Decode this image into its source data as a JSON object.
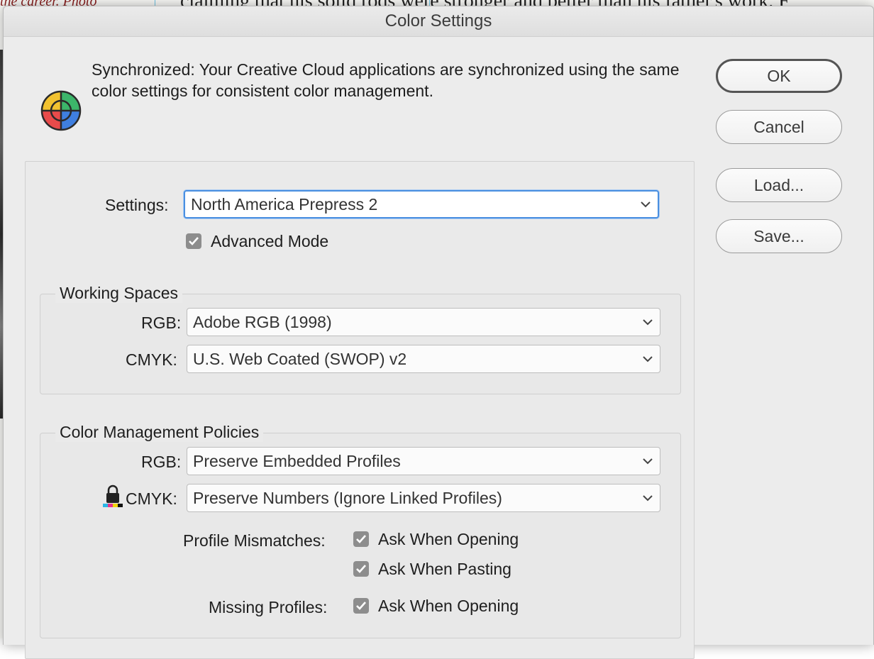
{
  "background": {
    "top_text": "claiming that his solid rods were stronger and better than his father's work. F",
    "left_text": "the career. Photo"
  },
  "dialog": {
    "title": "Color Settings",
    "sync_message": "Synchronized: Your Creative Cloud applications are synchronized using the same color settings for consistent color management."
  },
  "buttons": {
    "ok": "OK",
    "cancel": "Cancel",
    "load": "Load...",
    "save": "Save..."
  },
  "settings": {
    "label": "Settings:",
    "value": "North America Prepress 2",
    "advanced_mode_label": "Advanced Mode",
    "advanced_mode_checked": true
  },
  "working_spaces": {
    "title": "Working Spaces",
    "rgb_label": "RGB:",
    "rgb_value": "Adobe RGB (1998)",
    "cmyk_label": "CMYK:",
    "cmyk_value": "U.S. Web Coated (SWOP) v2"
  },
  "policies": {
    "title": "Color Management Policies",
    "rgb_label": "RGB:",
    "rgb_value": "Preserve Embedded Profiles",
    "cmyk_label": "CMYK:",
    "cmyk_value": "Preserve Numbers (Ignore Linked Profiles)",
    "profile_mismatches_label": "Profile Mismatches:",
    "ask_when_opening_label": "Ask When Opening",
    "ask_when_opening_checked": true,
    "ask_when_pasting_label": "Ask When Pasting",
    "ask_when_pasting_checked": true,
    "missing_profiles_label": "Missing Profiles:",
    "missing_ask_when_opening_label": "Ask When Opening",
    "missing_ask_when_opening_checked": true
  },
  "colors": {
    "focus_ring": "#4a8fe0",
    "checkbox": "#8d8d8d",
    "logo_red": "#e94b4b",
    "logo_yellow": "#f2c230",
    "logo_green": "#3cb66a",
    "logo_blue": "#3f7fe0"
  },
  "icons": {
    "logo": "color-wheel-logo-icon",
    "lock": "lock-icon",
    "chevron": "chevron-down-icon",
    "check": "checkmark-icon"
  }
}
